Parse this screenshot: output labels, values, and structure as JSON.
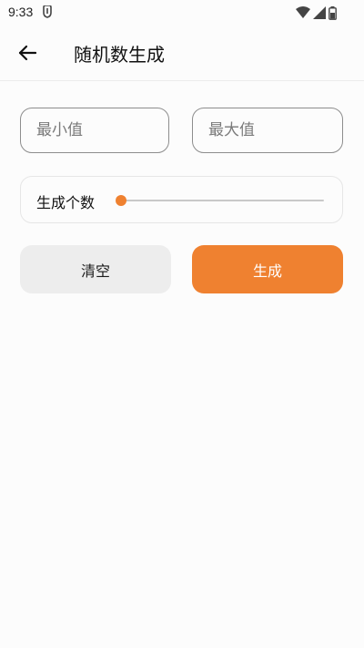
{
  "status_bar": {
    "time": "9:33",
    "icons": [
      "notification-icon",
      "wifi-icon",
      "signal-icon",
      "battery-icon"
    ]
  },
  "app_bar": {
    "title": "随机数生成",
    "back_icon": "arrow-left-icon"
  },
  "form": {
    "min_placeholder": "最小值",
    "max_placeholder": "最大值",
    "min_value": "",
    "max_value": "",
    "count_label": "生成个数",
    "count_slider_level": 0
  },
  "buttons": {
    "clear_label": "清空",
    "generate_label": "生成"
  },
  "colors": {
    "accent": "#ef8130",
    "clear_button_bg": "#ededed",
    "input_border": "#8d8d8d",
    "background": "#fcfcfc"
  }
}
